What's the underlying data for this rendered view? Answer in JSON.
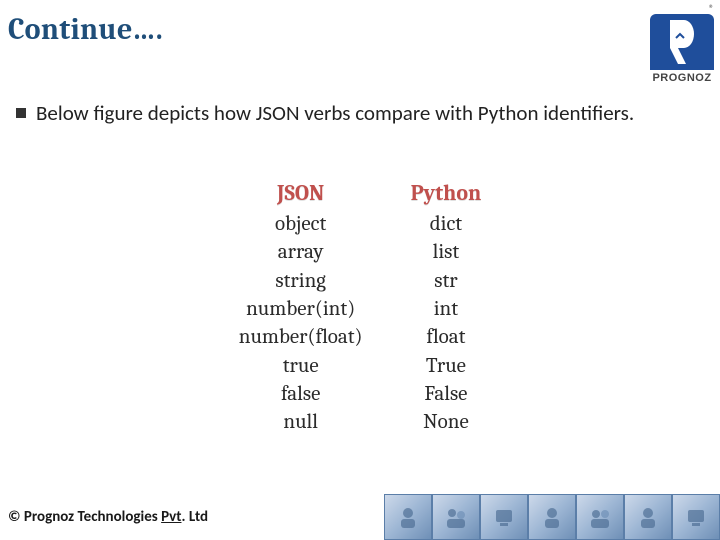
{
  "title": "Continue….",
  "logo": {
    "brand": "PROGNOZ",
    "registered": "®"
  },
  "bullet": "Below figure depicts how JSON verbs compare with Python identifiers.",
  "table": {
    "headers": {
      "json": "JSON",
      "python": "Python"
    },
    "rows": [
      {
        "json": "object",
        "python": "dict"
      },
      {
        "json": "array",
        "python": "list"
      },
      {
        "json": "string",
        "python": "str"
      },
      {
        "json": "number(int)",
        "python": "int"
      },
      {
        "json": "number(float)",
        "python": "float"
      },
      {
        "json": "true",
        "python": "True"
      },
      {
        "json": "false",
        "python": "False"
      },
      {
        "json": "null",
        "python": "None"
      }
    ]
  },
  "footer": {
    "copyright_prefix": "© Prognoz Technologies ",
    "copyright_suffix": "Pvt",
    "copyright_tail": ". Ltd"
  }
}
